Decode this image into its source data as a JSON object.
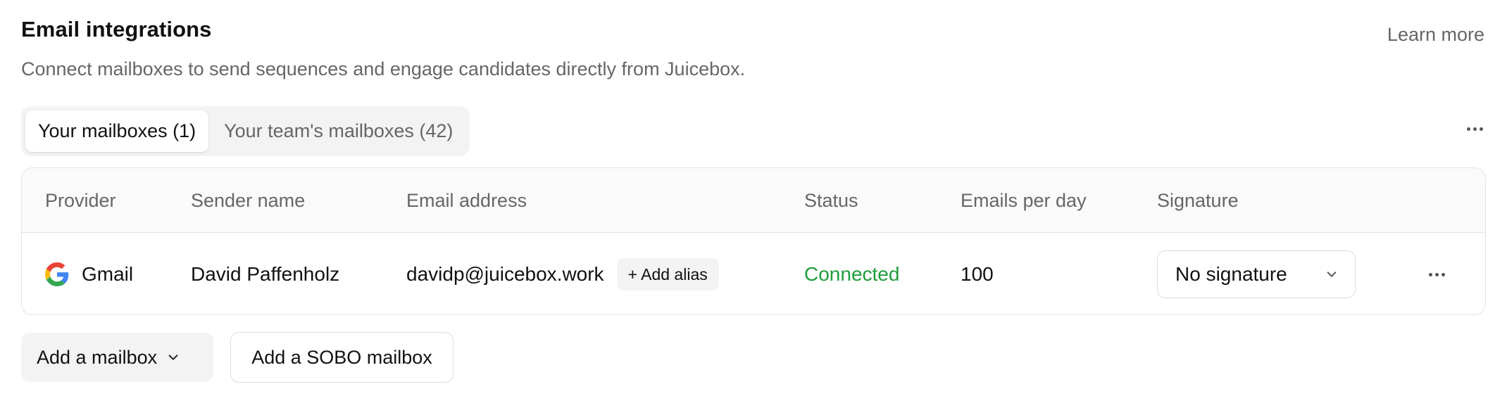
{
  "header": {
    "title": "Email integrations",
    "subtitle": "Connect mailboxes to send sequences and engage candidates directly from Juicebox.",
    "learn_more": "Learn more"
  },
  "tabs": [
    {
      "label": "Your mailboxes (1)",
      "active": true
    },
    {
      "label": "Your team's mailboxes (42)",
      "active": false
    }
  ],
  "table": {
    "columns": [
      "Provider",
      "Sender name",
      "Email address",
      "Status",
      "Emails per day",
      "Signature"
    ],
    "rows": [
      {
        "provider": "Gmail",
        "provider_icon": "google-icon",
        "sender_name": "David Paffenholz",
        "email": "davidp@juicebox.work",
        "add_alias_label": "+ Add alias",
        "status": "Connected",
        "emails_per_day": "100",
        "signature": "No signature"
      }
    ]
  },
  "actions": {
    "add_mailbox": "Add a mailbox",
    "add_sobo_mailbox": "Add a SOBO mailbox"
  },
  "colors": {
    "status_connected": "#1f9d3a",
    "muted_text": "#666666",
    "border": "#e4e4e4"
  }
}
